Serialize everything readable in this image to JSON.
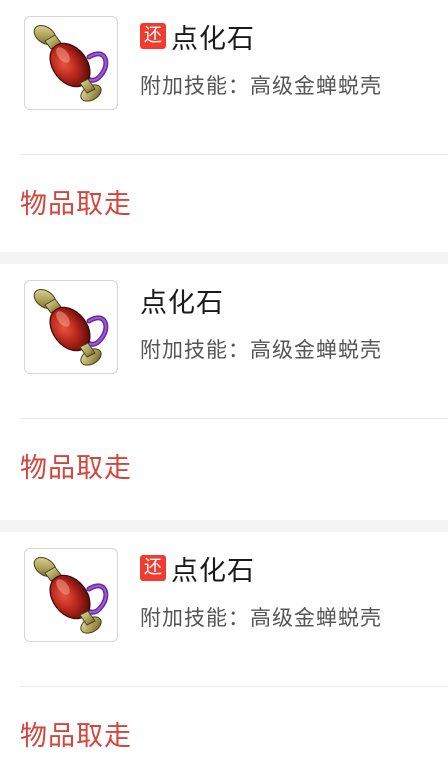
{
  "items": [
    {
      "badge": "还",
      "name": "点化石",
      "skill_label": "附加技能：",
      "skill_value": "高级金蝉蜕壳",
      "action_label": "物品取走",
      "icon": "potion-bottle-icon",
      "colors": {
        "badge": "#f23b2f",
        "action": "#d4463c"
      }
    },
    {
      "badge": "",
      "name": "点化石",
      "skill_label": "附加技能：",
      "skill_value": "高级金蝉蜕壳",
      "action_label": "物品取走",
      "icon": "potion-bottle-icon",
      "colors": {
        "badge": "#f23b2f",
        "action": "#d4463c"
      }
    },
    {
      "badge": "还",
      "name": "点化石",
      "skill_label": "附加技能：",
      "skill_value": "高级金蝉蜕壳",
      "action_label": "物品取走",
      "icon": "potion-bottle-icon",
      "colors": {
        "badge": "#f23b2f",
        "action": "#d4463c"
      }
    }
  ]
}
